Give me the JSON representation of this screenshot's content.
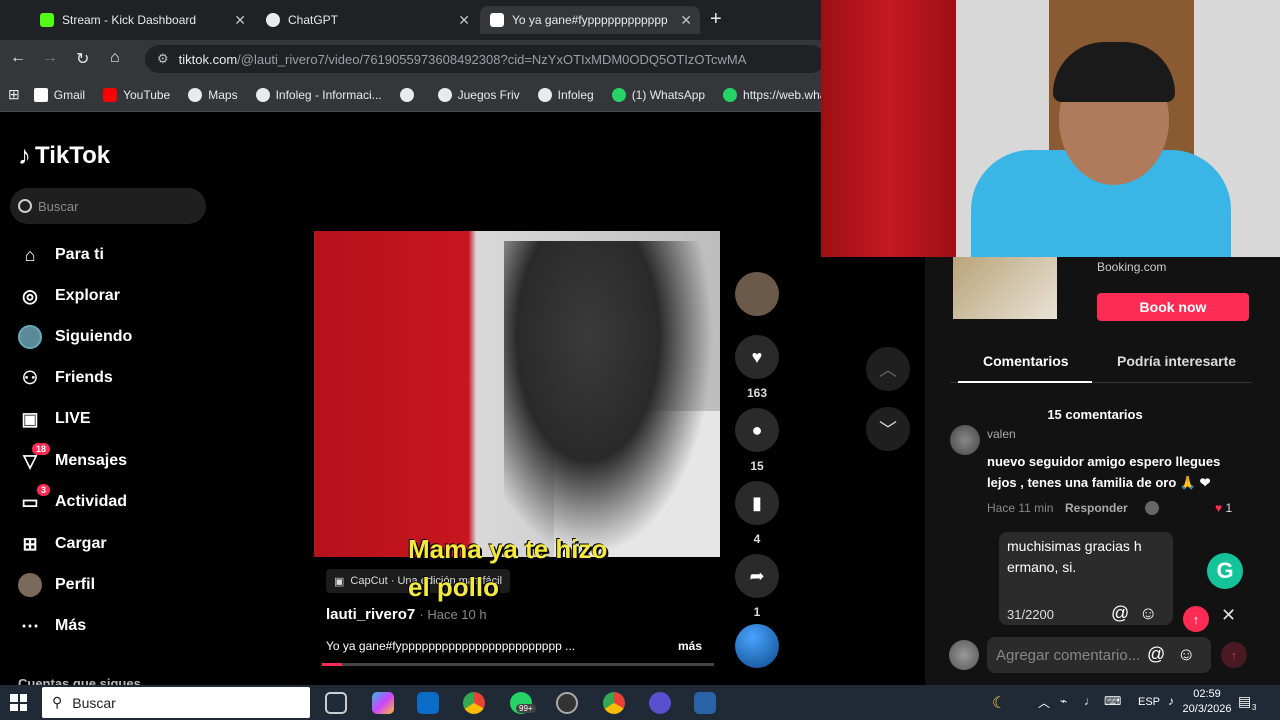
{
  "browser": {
    "tabs": [
      {
        "label": "Stream - Kick Dashboard",
        "active": false,
        "favicon_color": "#53fc18"
      },
      {
        "label": "ChatGPT",
        "active": false,
        "favicon_color": "#e8eaed"
      },
      {
        "label": "Yo ya gane#fypppppppppppp",
        "active": true,
        "favicon_color": "#ffffff"
      }
    ],
    "url_host": "tiktok.com",
    "url_path": "/@lauti_rivero7/video/7619055973608492308?cid=NzYxOTIxMDM0ODQ5OTIzOTcwMA",
    "bookmarks": [
      "Gmail",
      "YouTube",
      "Maps",
      "Infoleg - Informaci...",
      "",
      "Juegos Friv",
      "Infoleg",
      "(1) WhatsApp",
      "https://web.whats"
    ]
  },
  "sidebar": {
    "logo": "TikTok",
    "search_placeholder": "Buscar",
    "items": [
      {
        "label": "Para ti",
        "icon": "home-icon"
      },
      {
        "label": "Explorar",
        "icon": "compass-icon"
      },
      {
        "label": "Siguiendo",
        "icon": "following-avatar-icon"
      },
      {
        "label": "Friends",
        "icon": "friends-icon"
      },
      {
        "label": "LIVE",
        "icon": "live-icon"
      },
      {
        "label": "Mensajes",
        "icon": "messages-icon",
        "badge": "18"
      },
      {
        "label": "Actividad",
        "icon": "activity-icon",
        "badge": "3"
      },
      {
        "label": "Cargar",
        "icon": "upload-icon"
      },
      {
        "label": "Perfil",
        "icon": "profile-avatar-icon"
      },
      {
        "label": "Más",
        "icon": "more-icon"
      }
    ],
    "following_header": "Cuentas que sigues"
  },
  "video": {
    "overlay_caption": "Mama ya te hizo el pollo",
    "capcut_label": "CapCut · Una edición más fácil",
    "author": "lauti_rivero7",
    "posted": "· Hace 10 h",
    "description": "Yo ya gane#fypppppppppppppppppppppppp ...",
    "more_label": "más",
    "progress_fraction": 0.05
  },
  "actions": {
    "likes": "163",
    "comments": "15",
    "saves": "4",
    "shares": "1"
  },
  "panel": {
    "ad_brand": "Booking.com",
    "ad_button": "Book now",
    "tab_comments": "Comentarios",
    "tab_related": "Podría interesarte",
    "comments_count": "15 comentarios",
    "comment": {
      "user": "valen",
      "text": "nuevo seguidor amigo espero llegues lejos , tenes una familia de oro 🙏 ❤",
      "time": "Hace 11 min",
      "reply_label": "Responder",
      "likes": "1"
    },
    "reply_draft": "muchisimas gracias h ermano, si.",
    "reply_counter": "31/2200",
    "add_comment_placeholder": "Agregar comentario..."
  },
  "taskbar": {
    "search_placeholder": "Buscar",
    "whatsapp_badge": "99+",
    "language": "ESP",
    "time": "02:59",
    "date": "20/3/2026",
    "notifications": "3"
  }
}
